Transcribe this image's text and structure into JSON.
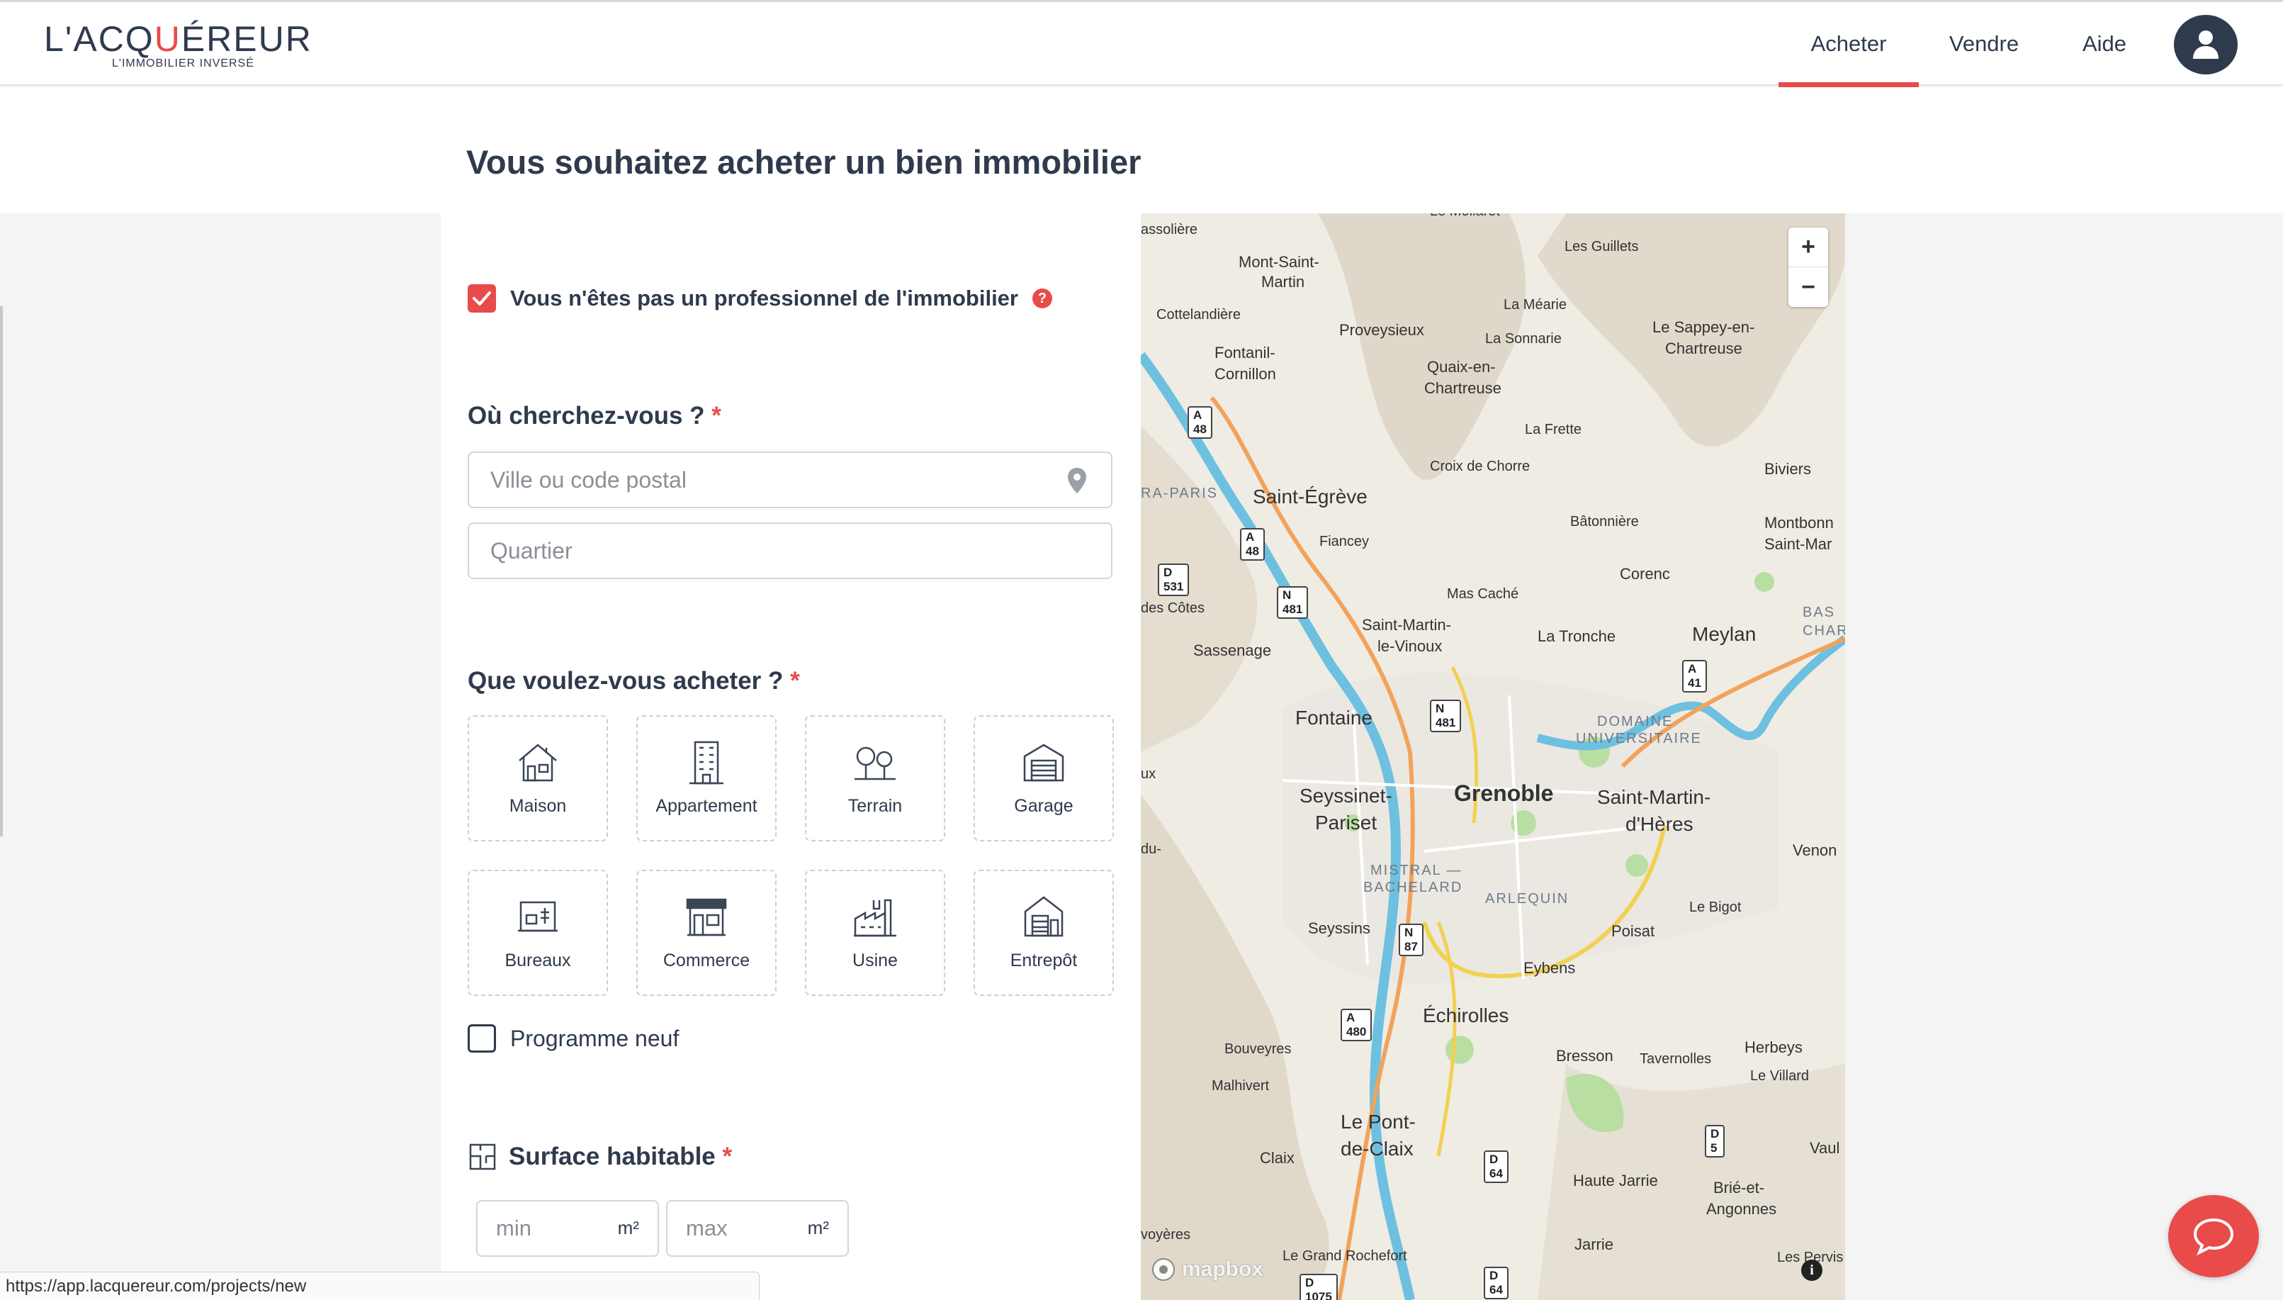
{
  "header": {
    "logo_text_before": "L'ACQ",
    "logo_q": "U",
    "logo_text_after": "ÉREUR",
    "logo_subtitle": "L'IMMOBILIER INVERSÉ",
    "nav": [
      {
        "label": "Acheter",
        "active": true
      },
      {
        "label": "Vendre",
        "active": false
      },
      {
        "label": "Aide",
        "active": false
      }
    ],
    "avatar_icon": "user-icon"
  },
  "page": {
    "title": "Vous souhaitez acheter un bien immobilier"
  },
  "form": {
    "not_professional": {
      "label": "Vous n'êtes pas un professionnel de l'immobilier",
      "checked": true,
      "help": "?"
    },
    "location": {
      "label": "Où cherchez-vous ?",
      "required_mark": "*",
      "city_placeholder": "Ville ou code postal",
      "district_placeholder": "Quartier"
    },
    "property": {
      "label": "Que voulez-vous acheter ?",
      "required_mark": "*",
      "types": [
        {
          "label": "Maison",
          "icon": "house-icon"
        },
        {
          "label": "Appartement",
          "icon": "apartment-icon"
        },
        {
          "label": "Terrain",
          "icon": "land-icon"
        },
        {
          "label": "Garage",
          "icon": "garage-icon"
        },
        {
          "label": "Bureaux",
          "icon": "office-icon"
        },
        {
          "label": "Commerce",
          "icon": "shop-icon"
        },
        {
          "label": "Usine",
          "icon": "factory-icon"
        },
        {
          "label": "Entrepôt",
          "icon": "warehouse-icon"
        }
      ]
    },
    "new_program": {
      "label": "Programme neuf",
      "checked": false
    },
    "surface": {
      "label": "Surface habitable",
      "required_mark": "*",
      "min_placeholder": "min",
      "max_placeholder": "max",
      "unit": "m²"
    }
  },
  "map": {
    "zoom_in": "+",
    "zoom_out": "−",
    "attribution": "mapbox",
    "info": "i",
    "places": [
      {
        "name": "Le Mollaret",
        "size": "s"
      },
      {
        "name": "assolière",
        "size": "s"
      },
      {
        "name": "Les Guillets",
        "size": "s"
      },
      {
        "name": "Mont-Saint-",
        "size": "s"
      },
      {
        "name": "Martin",
        "size": "s"
      },
      {
        "name": "La Méarie",
        "size": "s"
      },
      {
        "name": "Cottelandière",
        "size": "s"
      },
      {
        "name": "Proveysieux",
        "size": "s"
      },
      {
        "name": "La Sonnarie",
        "size": "s"
      },
      {
        "name": "Le Sappey-en-",
        "size": "s"
      },
      {
        "name": "Chartreuse",
        "size": "s"
      },
      {
        "name": "Fontanil-",
        "size": "s"
      },
      {
        "name": "Cornillon",
        "size": "s"
      },
      {
        "name": "Quaix-en-",
        "size": "s"
      },
      {
        "name": "Chartreuse",
        "size": "s"
      },
      {
        "name": "La Frette",
        "size": "s"
      },
      {
        "name": "Croix de Chorre",
        "size": "s"
      },
      {
        "name": "Biviers",
        "size": "s"
      },
      {
        "name": "RA-PARIS",
        "size": "d"
      },
      {
        "name": "Saint-Égrève",
        "size": "m"
      },
      {
        "name": "Bâtonnière",
        "size": "s"
      },
      {
        "name": "Montbonn",
        "size": "s"
      },
      {
        "name": "Saint-Mar",
        "size": "s"
      },
      {
        "name": "Fiancey",
        "size": "s"
      },
      {
        "name": "Corenc",
        "size": "s"
      },
      {
        "name": "Mas Caché",
        "size": "s"
      },
      {
        "name": "BAS",
        "size": "d"
      },
      {
        "name": "CHARLA",
        "size": "d"
      },
      {
        "name": "des Côtes",
        "size": "s"
      },
      {
        "name": "Saint-Martin-",
        "size": "s"
      },
      {
        "name": "le-Vinoux",
        "size": "s"
      },
      {
        "name": "La Tronche",
        "size": "s"
      },
      {
        "name": "Meylan",
        "size": "m"
      },
      {
        "name": "Sassenage",
        "size": "s"
      },
      {
        "name": "Fontaine",
        "size": "m"
      },
      {
        "name": "DOMAINE",
        "size": "d"
      },
      {
        "name": "UNIVERSITAIRE",
        "size": "d"
      },
      {
        "name": "Seyssinet-",
        "size": "m"
      },
      {
        "name": "Pariset",
        "size": "m"
      },
      {
        "name": "Grenoble",
        "size": "l"
      },
      {
        "name": "Saint-Martin-",
        "size": "m"
      },
      {
        "name": "d'Hères",
        "size": "m"
      },
      {
        "name": "Venon",
        "size": "s"
      },
      {
        "name": "MISTRAL —",
        "size": "d"
      },
      {
        "name": "BACHELARD",
        "size": "d"
      },
      {
        "name": "ARLEQUIN",
        "size": "d"
      },
      {
        "name": "Le Bigot",
        "size": "s"
      },
      {
        "name": "Seyssins",
        "size": "s"
      },
      {
        "name": "Poisat",
        "size": "s"
      },
      {
        "name": "Eybens",
        "size": "s"
      },
      {
        "name": "Échirolles",
        "size": "m"
      },
      {
        "name": "Bouveyres",
        "size": "s"
      },
      {
        "name": "Bresson",
        "size": "s"
      },
      {
        "name": "Tavernolles",
        "size": "s"
      },
      {
        "name": "Herbeys",
        "size": "s"
      },
      {
        "name": "Malhivert",
        "size": "s"
      },
      {
        "name": "Le Villard",
        "size": "s"
      },
      {
        "name": "Le Pont-",
        "size": "m"
      },
      {
        "name": "de-Claix",
        "size": "m"
      },
      {
        "name": "Claix",
        "size": "s"
      },
      {
        "name": "Haute Jarrie",
        "size": "s"
      },
      {
        "name": "Brié-et-",
        "size": "s"
      },
      {
        "name": "Angonnes",
        "size": "s"
      },
      {
        "name": "Vaul",
        "size": "s"
      },
      {
        "name": "voyères",
        "size": "s"
      },
      {
        "name": "Jarrie",
        "size": "s"
      },
      {
        "name": "Le Grand Rochefort",
        "size": "s"
      },
      {
        "name": "Les Pervis",
        "size": "s"
      },
      {
        "name": "du-",
        "size": "s"
      },
      {
        "name": "ux",
        "size": "s"
      }
    ],
    "roads": [
      "A 48",
      "A 48",
      "D 531",
      "N 481",
      "N 481",
      "A 41",
      "N 87",
      "A 480",
      "D 5",
      "D 64",
      "D 64",
      "D 1075"
    ]
  },
  "chat": {
    "icon": "chat-icon"
  },
  "statusbar": {
    "url": "https://app.lacquereur.com/projects/new"
  }
}
